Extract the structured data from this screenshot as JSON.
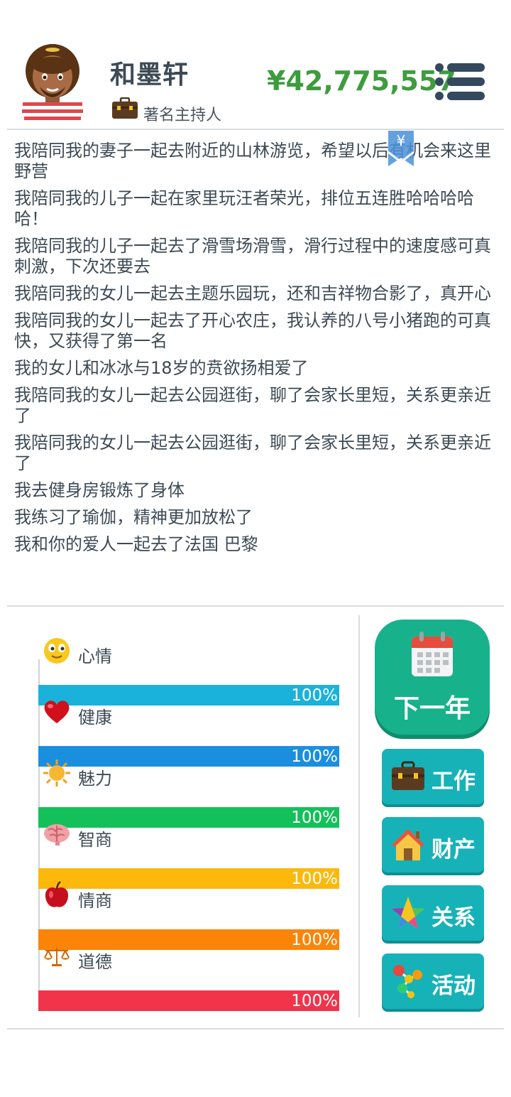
{
  "player": {
    "name": "和墨轩",
    "job": "著名主持人",
    "money": "¥42,775,557"
  },
  "bookmark_symbol": "¥",
  "log": [
    "我陪同我的妻子一起去附近的山林游览，希望以后有机会来这里野营",
    "我陪同我的儿子一起在家里玩汪者荣光，排位五连胜哈哈哈哈哈！",
    "我陪同我的儿子一起去了滑雪场滑雪，滑行过程中的速度感可真刺激，下次还要去",
    "我陪同我的女儿一起去主题乐园玩，还和吉祥物合影了，真开心",
    "我陪同我的女儿一起去了开心农庄，我认养的八号小猪跑的可真快，又获得了第一名",
    "我的女儿和冰冰与18岁的贲欲扬相爱了",
    "我陪同我的女儿一起去公园逛街，聊了会家长里短，关系更亲近了",
    "我陪同我的女儿一起去公园逛街，聊了会家长里短，关系更亲近了",
    "我去健身房锻炼了身体",
    "我练习了瑜伽，精神更加放松了",
    "我和你的爱人一起去了法国 巴黎"
  ],
  "stats": [
    {
      "label": "心情",
      "value": "100%",
      "level": 1.0,
      "color": "#1ab2da",
      "icon": "smiley-icon"
    },
    {
      "label": "健康",
      "value": "100%",
      "level": 1.0,
      "color": "#1a8fe0",
      "icon": "heart-icon"
    },
    {
      "label": "魅力",
      "value": "100%",
      "level": 1.0,
      "color": "#14c05a",
      "icon": "sun-icon"
    },
    {
      "label": "智商",
      "value": "100%",
      "level": 1.0,
      "color": "#fcb90c",
      "icon": "brain-icon"
    },
    {
      "label": "情商",
      "value": "100%",
      "level": 1.0,
      "color": "#fb8409",
      "icon": "apple-icon"
    },
    {
      "label": "道德",
      "value": "100%",
      "level": 1.0,
      "color": "#f1344a",
      "icon": "scales-icon"
    }
  ],
  "actions": {
    "next_year": "下一年",
    "work": "工作",
    "property": "财产",
    "relations": "关系",
    "activities": "活动"
  },
  "colors": {
    "money": "#3e9c3e",
    "next_year_button": "#17b28c",
    "side_button": "#16b2b8"
  }
}
